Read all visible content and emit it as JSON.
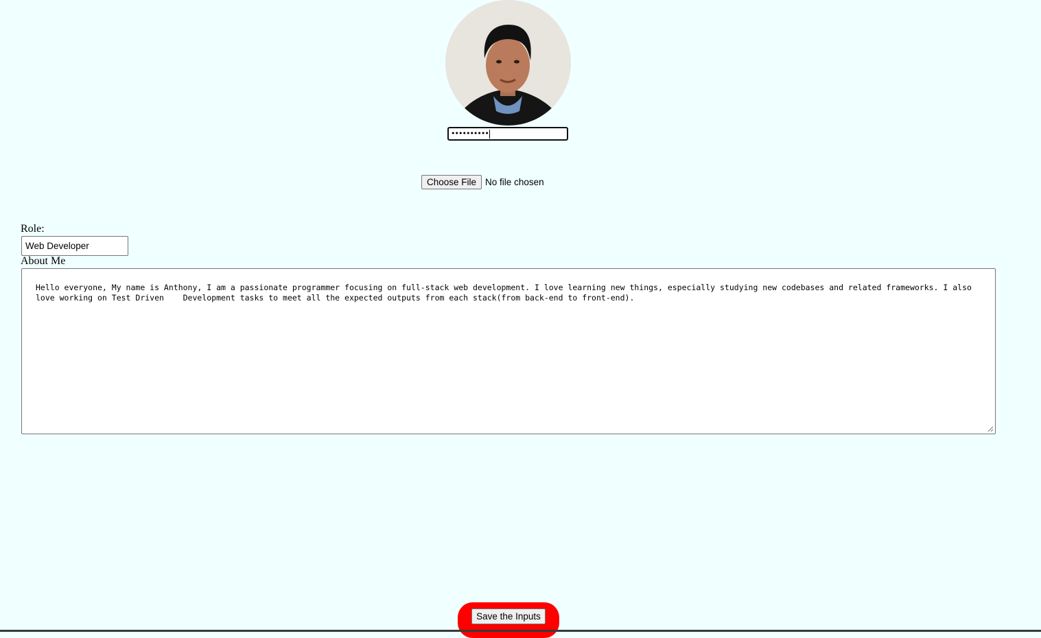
{
  "profile": {
    "avatar_icon": "person-photo",
    "password_value": "••••••••••"
  },
  "file_upload": {
    "button_label": "Choose File",
    "status_text": "No file chosen"
  },
  "role": {
    "label": "Role:",
    "value": "Web Developer"
  },
  "about": {
    "label": "About Me",
    "value": "Hello everyone, My name is Anthony, I am a passionate programmer focusing on full-stack web development. I love learning new things, especially studying new codebases and related frameworks. I also love working on Test Driven    Development tasks to meet all the expected outputs from each stack(from back-end to front-end)."
  },
  "actions": {
    "save_label": "Save the Inputs",
    "save_accent_color": "#ff0000"
  },
  "colors": {
    "page_background": "#f0ffff"
  }
}
